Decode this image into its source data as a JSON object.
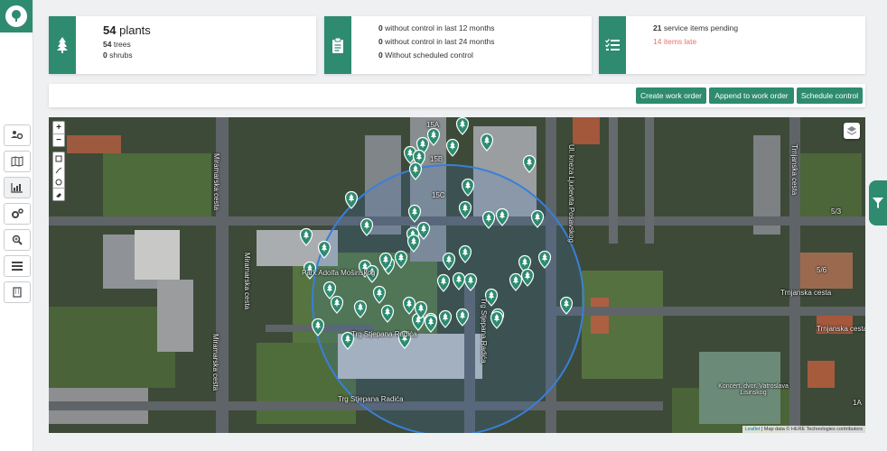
{
  "sidebar": {
    "logo_icon": "tree-logo-icon",
    "items": [
      {
        "name": "users-gear-icon"
      },
      {
        "name": "map-icon"
      },
      {
        "name": "chart-icon"
      },
      {
        "name": "settings-gears-icon"
      },
      {
        "name": "zoom-search-icon"
      },
      {
        "name": "list-icon"
      },
      {
        "name": "building-icon"
      }
    ]
  },
  "cards": {
    "plants": {
      "icon": "tree-icon",
      "count": "54",
      "label": "plants",
      "trees_count": "54",
      "trees_label": "trees",
      "shrubs_count": "0",
      "shrubs_label": "shrubs"
    },
    "control": {
      "icon": "clipboard-icon",
      "rows": [
        {
          "count": "0",
          "label": "without control in last 12 months"
        },
        {
          "count": "0",
          "label": "without control in last 24 months"
        },
        {
          "count": "0",
          "label": "Without scheduled control"
        }
      ]
    },
    "service": {
      "icon": "checklist-icon",
      "pending_count": "21",
      "pending_label": "service items pending",
      "late_count": "14",
      "late_label": "items late",
      "late_color": "#e8726a"
    }
  },
  "toolbar": {
    "create_label": "Create work order",
    "append_label": "Append to work order",
    "schedule_label": "Schedule control"
  },
  "map": {
    "zoom_in": "+",
    "zoom_out": "−",
    "labels": {
      "miramarska_1": "Miramarska cesta",
      "miramarska_2": "Miramarska cesta",
      "miramarska_3": "Miramarska cesta",
      "stjepana_1": "Trg Stjepana Radića",
      "stjepana_2": "Trg Stjepana Radića",
      "stjepana_3": "Trg Stjepana Radića",
      "trnjanska_1": "Trnjanska cesta",
      "trnjanska_2": "Trnjanska cesta",
      "trnjanska_3": "Trnjanska cesta",
      "kneza": "Ul. kneza Ljudevita Posavskog",
      "mosinsko": "Park Adolfa Mošinskog",
      "koncert": "Koncert. dvor. Vatroslava Lisinskog",
      "b15a": "15A",
      "b15b": "15B",
      "b15c": "15C",
      "b5_6": "5/6",
      "b5_3": "5/3",
      "b1a": "1A"
    },
    "circle_color": "#3a7fd8",
    "marker_color": "#2e8b6f",
    "attr_leaflet": "Leaflet",
    "attr_rest": " | Map data © HERE Technologies contributors"
  },
  "colors": {
    "accent": "#2e8b6f"
  }
}
